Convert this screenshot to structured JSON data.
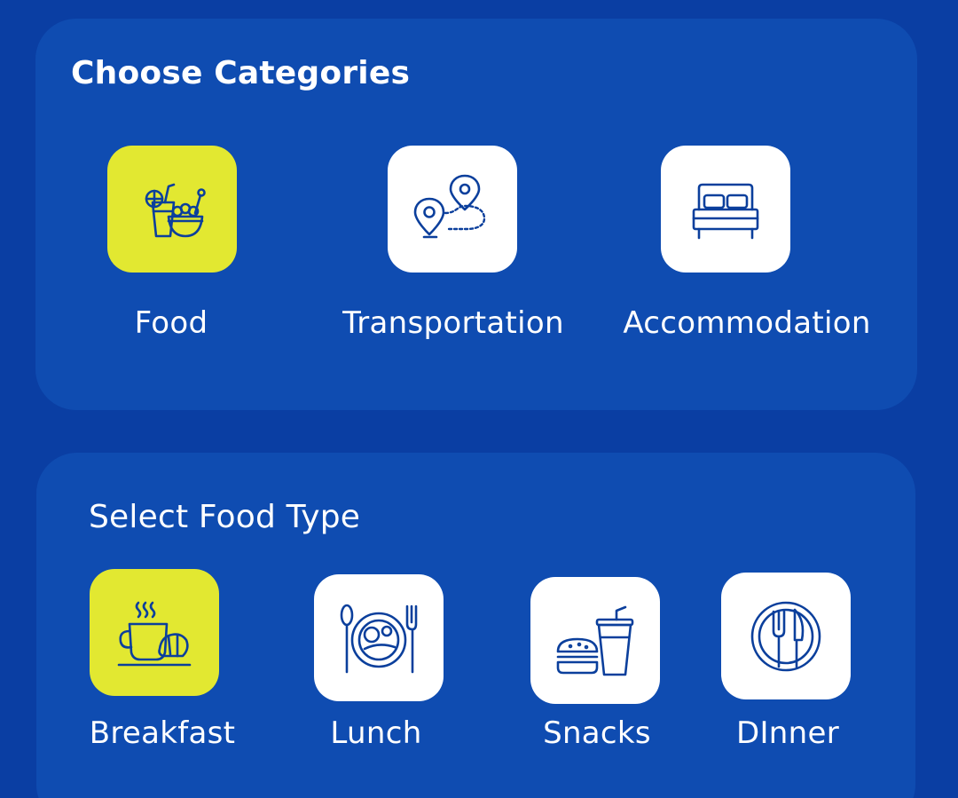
{
  "categories": {
    "title": "Choose Categories",
    "items": [
      {
        "label": "Food",
        "icon": "food-drink-icon",
        "selected": true
      },
      {
        "label": "Transportation",
        "icon": "route-pins-icon",
        "selected": false
      },
      {
        "label": "Accommodation",
        "icon": "bed-icon",
        "selected": false
      }
    ]
  },
  "food_type": {
    "title": "Select Food Type",
    "items": [
      {
        "label": "Breakfast",
        "icon": "coffee-croissant-icon",
        "selected": true
      },
      {
        "label": "Lunch",
        "icon": "plate-cutlery-icon",
        "selected": false
      },
      {
        "label": "Snacks",
        "icon": "burger-drink-icon",
        "selected": false
      },
      {
        "label": "DInner",
        "icon": "dinner-plate-icon",
        "selected": false
      }
    ]
  },
  "colors": {
    "background": "#0a3ea3",
    "card": "#0f4cb1",
    "selected_tile": "#e2e831",
    "tile": "#ffffff",
    "icon_stroke": "#0b3f9c",
    "text": "#ffffff"
  }
}
